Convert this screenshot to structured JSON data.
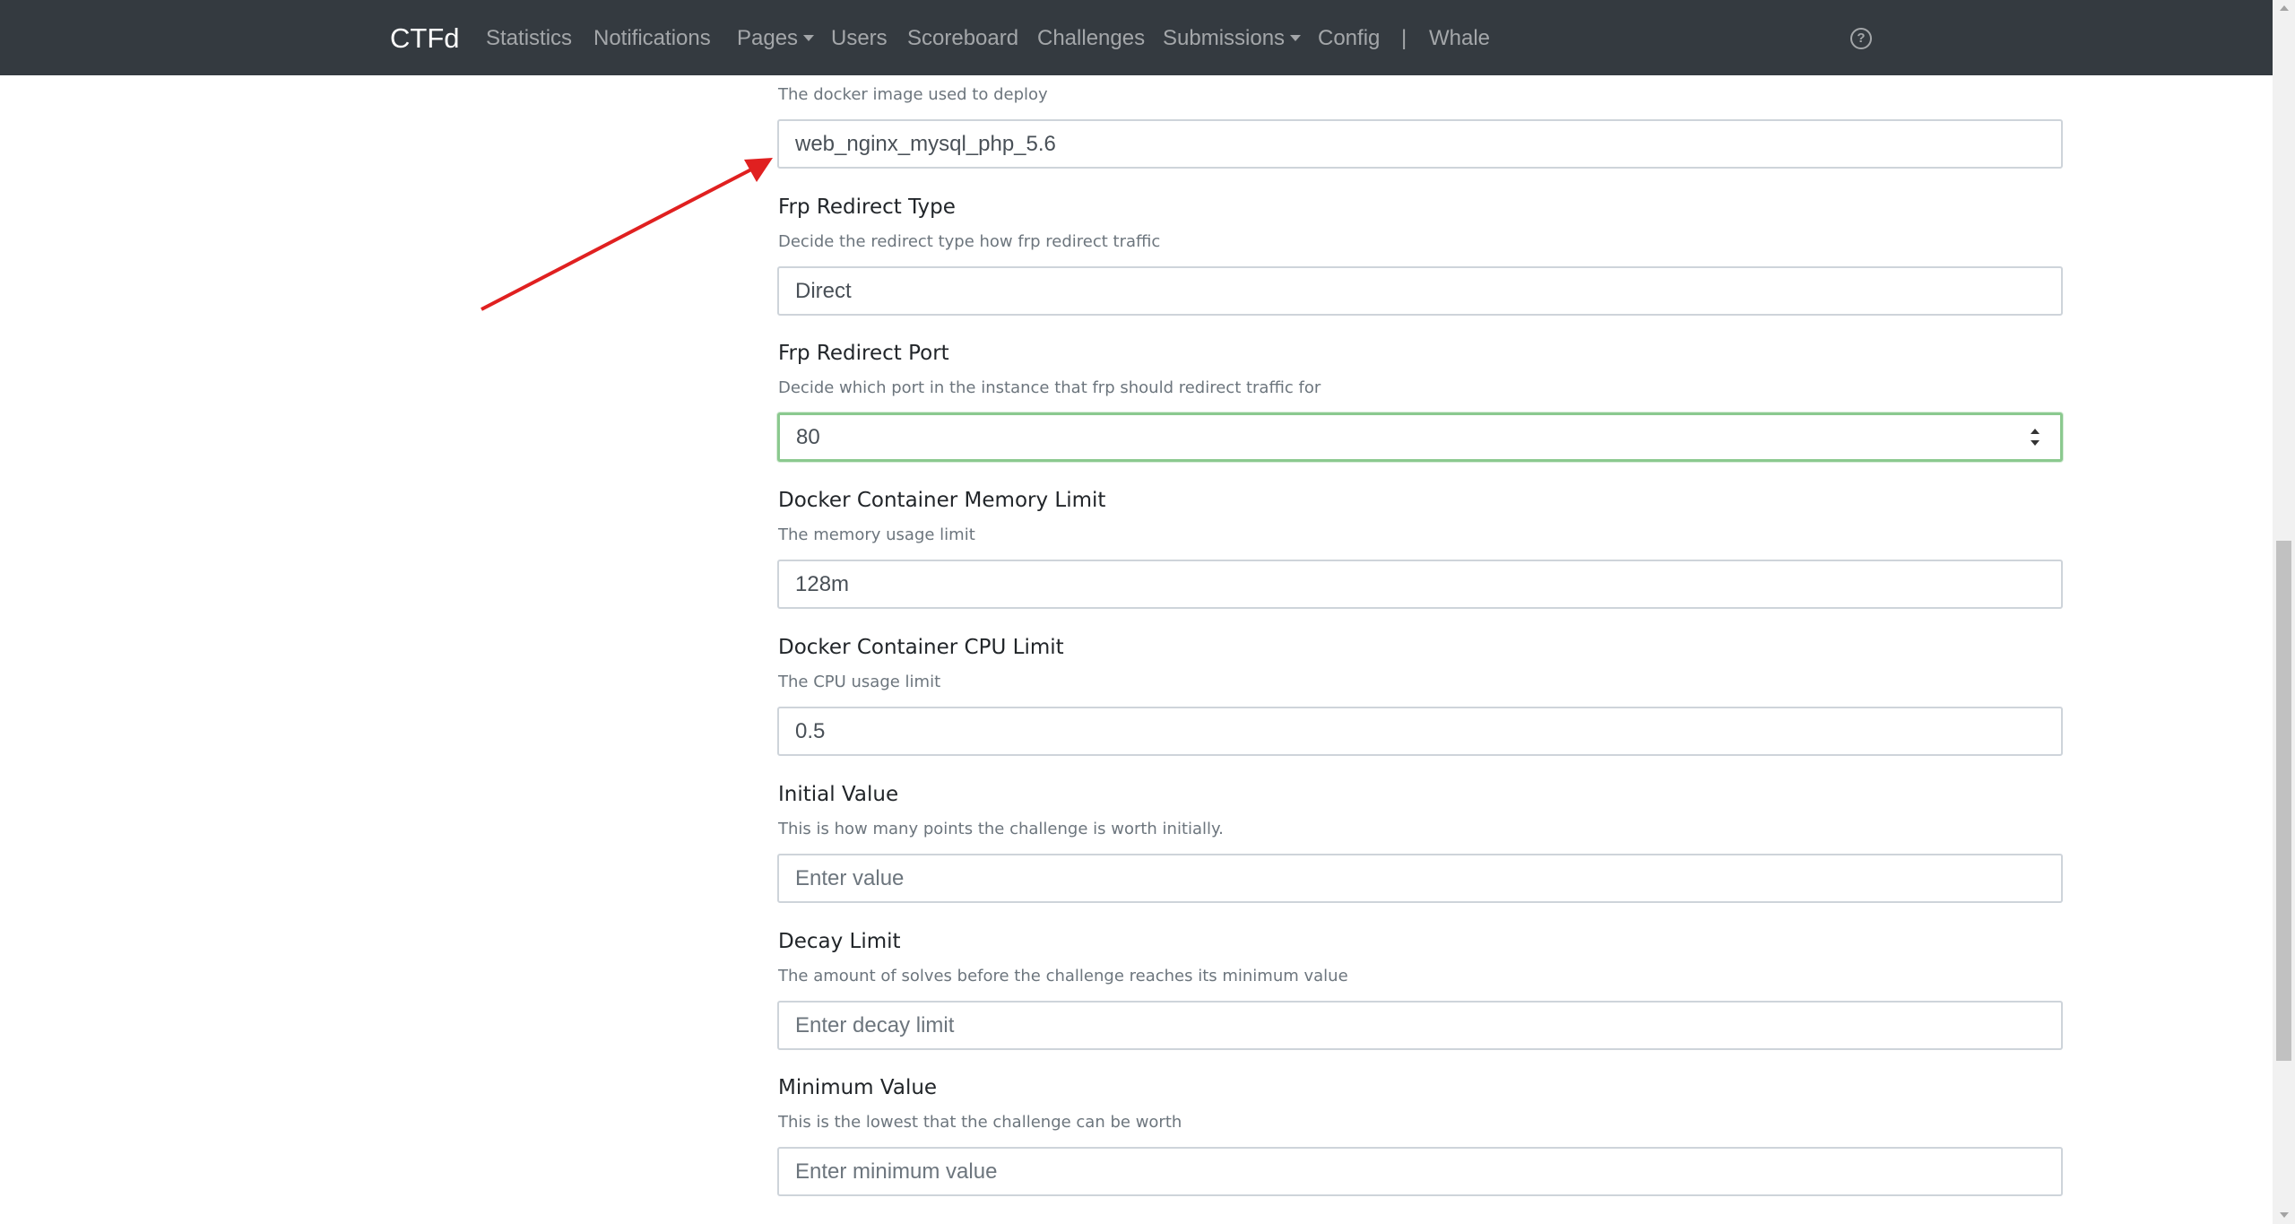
{
  "navbar": {
    "brand": "CTFd",
    "items": [
      {
        "label": "Statistics"
      },
      {
        "label": "Notifications"
      },
      {
        "label": "Pages"
      },
      {
        "label": "Users"
      },
      {
        "label": "Scoreboard"
      },
      {
        "label": "Challenges"
      },
      {
        "label": "Submissions"
      },
      {
        "label": "Config"
      },
      {
        "label": "|"
      },
      {
        "label": "Whale"
      }
    ],
    "help_icon": "question-circle-icon"
  },
  "form": {
    "docker_image": {
      "help": "The docker image used to deploy",
      "value": "web_nginx_mysql_php_5.6"
    },
    "frp_redirect_type": {
      "label": "Frp Redirect Type",
      "help": "Decide the redirect type how frp redirect traffic",
      "value": "Direct"
    },
    "frp_redirect_port": {
      "label": "Frp Redirect Port",
      "help": "Decide which port in the instance that frp should redirect traffic for",
      "value": "80"
    },
    "memory_limit": {
      "label": "Docker Container Memory Limit",
      "help": "The memory usage limit",
      "value": "128m"
    },
    "cpu_limit": {
      "label": "Docker Container CPU Limit",
      "help": "The CPU usage limit",
      "value": "0.5"
    },
    "initial_value": {
      "label": "Initial Value",
      "help": "This is how many points the challenge is worth initially.",
      "placeholder": "Enter value"
    },
    "decay_limit": {
      "label": "Decay Limit",
      "help": "The amount of solves before the challenge reaches its minimum value",
      "placeholder": "Enter decay limit"
    },
    "minimum_value": {
      "label": "Minimum Value",
      "help": "This is the lowest that the challenge can be worth",
      "placeholder": "Enter minimum value"
    }
  },
  "colors": {
    "navbar_bg": "#343a40",
    "focus_border": "#8bc98f",
    "annotation_arrow": "#e02020"
  }
}
